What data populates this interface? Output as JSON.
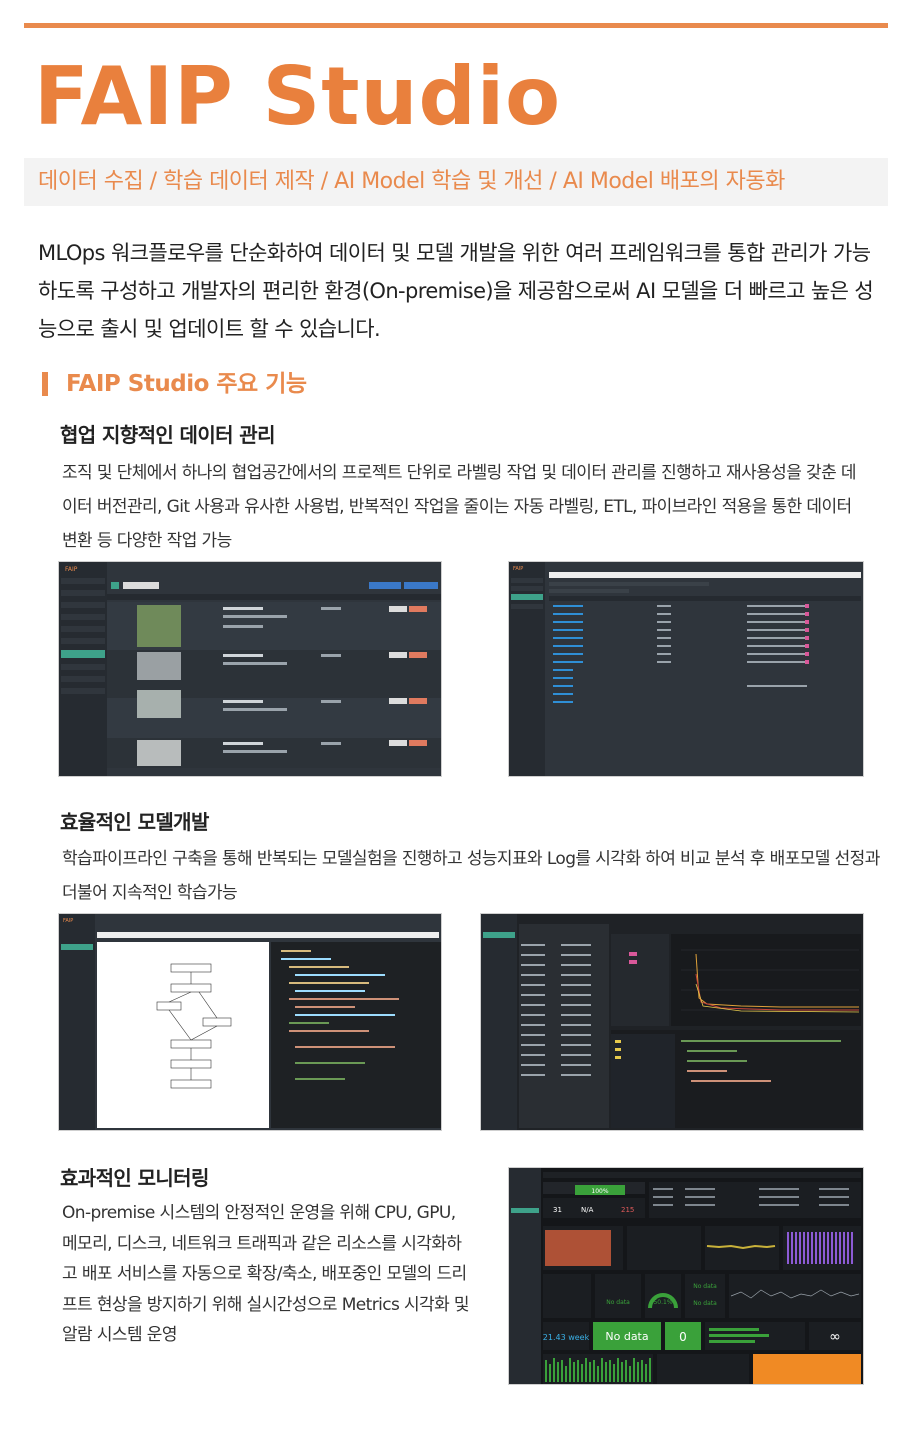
{
  "title": "FAIP Studio",
  "subtitle": "데이터 수집 / 학습 데이터 제작 / AI Model 학습 및 개선 / AI Model 배포의 자동화",
  "intro": "MLOps 워크플로우를 단순화하여 데이터 및 모델 개발을 위한 여러 프레임워크를 통합 관리가 가능하도록 구성하고 개발자의 편리한 환경(On-premise)을 제공함으로써 AI 모델을 더 빠르고 높은 성능으로 출시 및 업데이트 할 수 있습니다.",
  "section_heading": "FAIP Studio 주요 기능",
  "features": [
    {
      "title": "협업 지향적인 데이터 관리",
      "description": "조직 및 단체에서 하나의 협업공간에서의 프로젝트 단위로 라벨링 작업 및 데이터 관리를 진행하고 재사용성을 갖춘 데이터 버전관리, Git 사용과 유사한 사용법, 반복적인 작업을 줄이는 자동 라벨링, ETL, 파이브라인 적용을 통한 데이터 변환 등 다양한 작업 가능"
    },
    {
      "title": "효율적인 모델개발",
      "description": "학습파이프라인 구축을 통해 반복되는 모델실험을 진행하고 성능지표와 Log를 시각화 하여 비교 분석 후 배포모델 선정과 더불어 지속적인 학습가능"
    },
    {
      "title": "효과적인 모니터링",
      "description": "On-premise 시스템의 안정적인 운영을 위해 CPU, GPU, 메모리, 디스크, 네트워크 트래픽과 같은 리소스를 시각화하고 배포 서비스를 자동으로 확장/축소, 배포중인 모델의 드리프트 현상을 방지하기 위해 실시간성으로 Metrics 시각화 및 알람 시스템 운영"
    }
  ],
  "screenshots": {
    "brand": "FAIP",
    "dashboard": {
      "stat_1": "100%",
      "stat_2": "31",
      "stat_3": "N/A",
      "stat_4": "215",
      "gauge_1": "No data",
      "gauge_2": "50.1%",
      "gauge_3": "No data",
      "gauge_4": "No data",
      "big_1": "21.43 week",
      "big_2": "No data",
      "big_3": "0",
      "big_4": "∞"
    }
  },
  "colors": {
    "accent": "#e98a4d",
    "title": "#e9803d",
    "banner_bg": "#f3f3f3",
    "app_dark": "#2b3138",
    "app_green": "#3ea28a",
    "dashboard_green": "#3aa13a",
    "dashboard_orange": "#f08a24"
  }
}
